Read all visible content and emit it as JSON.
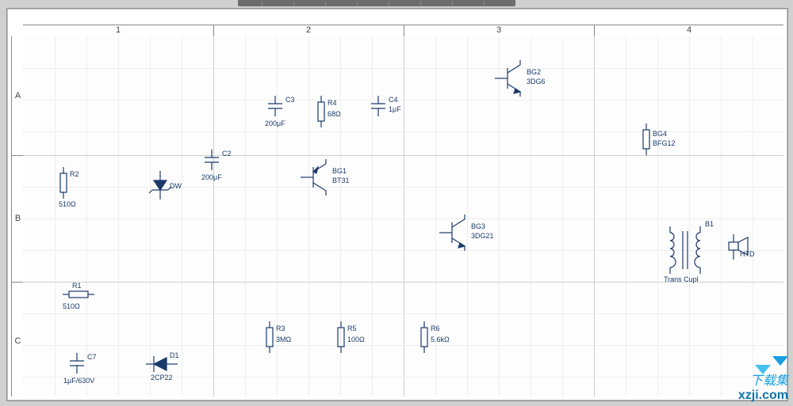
{
  "columns": [
    "1",
    "2",
    "3",
    "4"
  ],
  "rows": [
    "A",
    "B",
    "C"
  ],
  "components": {
    "R1": {
      "ref": "R1",
      "val": "510Ω"
    },
    "R2": {
      "ref": "R2",
      "val": "510Ω"
    },
    "R3": {
      "ref": "R3",
      "val": "3MΩ"
    },
    "R4": {
      "ref": "R4",
      "val": "68Ω"
    },
    "R5": {
      "ref": "R5",
      "val": "100Ω"
    },
    "R6": {
      "ref": "R6",
      "val": "5.6kΩ"
    },
    "C2": {
      "ref": "C2",
      "val": "200μF"
    },
    "C3": {
      "ref": "C3",
      "val": "200μF"
    },
    "C4": {
      "ref": "C4",
      "val": "1μF"
    },
    "C7": {
      "ref": "C7",
      "val": "1μF/630V"
    },
    "D1": {
      "ref": "D1",
      "val": "2CP22"
    },
    "DW": {
      "ref": "DW",
      "val": ""
    },
    "BG1": {
      "ref": "BG1",
      "val": "BT31"
    },
    "BG2": {
      "ref": "BG2",
      "val": "3DG6"
    },
    "BG3": {
      "ref": "BG3",
      "val": "3DG21"
    },
    "BG4": {
      "ref": "BG4",
      "val": "BFG12"
    },
    "B1": {
      "ref": "B1",
      "val": "Trans Cupl"
    },
    "HTD": {
      "ref": "HTD",
      "val": ""
    }
  },
  "watermark": {
    "line1": "下载集",
    "line2": "xzji.com"
  }
}
